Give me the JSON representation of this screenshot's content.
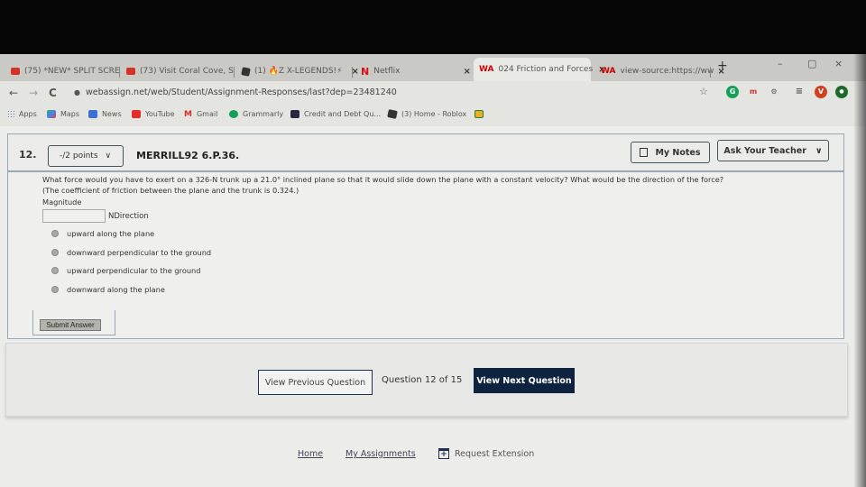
{
  "browser": {
    "tabs": [
      {
        "label": "(75) *NEW* SPLIT SCRE",
        "icon": "youtube-icon"
      },
      {
        "label": "(73) Visit Coral Cove, S",
        "icon": "youtube-icon"
      },
      {
        "label": "(1) 🔥Z X-LEGENDS!⚡",
        "icon": "roblox-icon"
      },
      {
        "label": "Netflix",
        "icon": "netflix-icon"
      },
      {
        "label": "024 Friction and Forces",
        "icon": "webassign-icon",
        "active": true
      },
      {
        "label": "view-source:https://ww",
        "icon": "webassign-icon"
      }
    ],
    "close_glyph": "×",
    "new_tab_glyph": "+",
    "window_controls": {
      "minimize": "–",
      "restore": "▢",
      "close": "×"
    },
    "nav": {
      "back": "←",
      "forward": "→",
      "reload": "C"
    },
    "url": "webassign.net/web/Student/Assignment-Responses/last?dep=23481240",
    "toolbar_icons": {
      "star": "☆",
      "grammarly": "G",
      "ext_m": "m",
      "ext_bug": "⚙",
      "media": "≡",
      "profile": "V",
      "ext_dot": "●"
    },
    "bookmarks": [
      {
        "label": "Apps",
        "icon": "apps-icon"
      },
      {
        "label": "Maps",
        "icon": "maps-icon"
      },
      {
        "label": "News",
        "icon": "news-icon"
      },
      {
        "label": "YouTube",
        "icon": "youtube-icon"
      },
      {
        "label": "Gmail",
        "icon": "gmail-icon"
      },
      {
        "label": "Grammarly",
        "icon": "grammarly-icon"
      },
      {
        "label": "Credit and Debt Qu...",
        "icon": "quizlet-icon"
      },
      {
        "label": "(3) Home - Roblox",
        "icon": "roblox-icon"
      },
      {
        "label": "",
        "icon": "classroom-icon"
      }
    ]
  },
  "question": {
    "number": "12.",
    "points": "-/2 points",
    "code": "MERRILL92 6.P.36.",
    "my_notes": "My Notes",
    "ask_teacher": "Ask Your Teacher",
    "text_line1": "What force would you have to exert on a 326-N trunk up a 21.0° inclined plane so that it would slide down the plane with a constant velocity? What would be the direction of the force?",
    "text_line2": "(The coefficient of friction between the plane and the trunk is 0.324.)",
    "magnitude_label": "Magnitude",
    "magnitude_value": "",
    "unit_direction_label": "NDirection",
    "options": [
      "upward along the plane",
      "downward perpendicular to the ground",
      "upward perpendicular to the ground",
      "downward along the plane"
    ],
    "submit": "Submit Answer"
  },
  "navigation": {
    "prev": "View Previous Question",
    "counter": "Question 12 of 15",
    "next": "View Next Question"
  },
  "footer": {
    "home": "Home",
    "assignments": "My Assignments",
    "extension": "Request Extension"
  },
  "colors": {
    "next_button_bg": "#0e2340",
    "card_border": "#9aa6b4"
  }
}
